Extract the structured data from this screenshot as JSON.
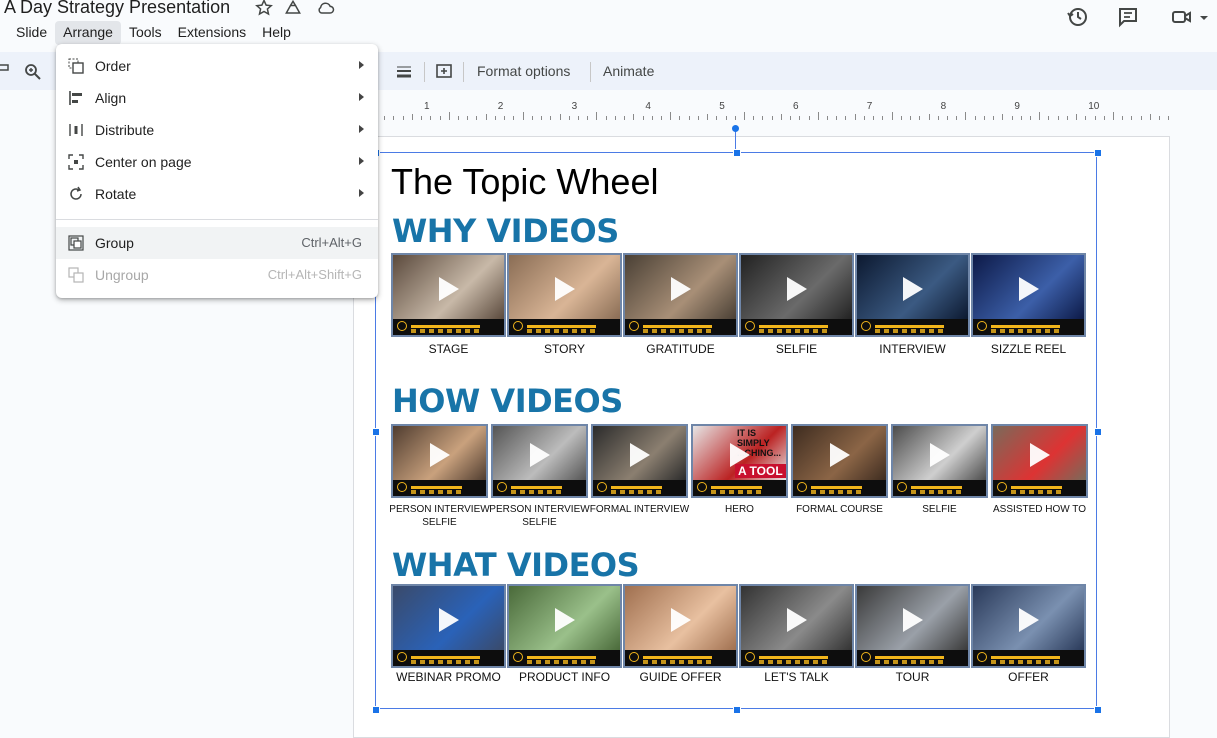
{
  "app": {
    "doc_title": "r A Day Strategy Presentation",
    "menus": [
      "Slide",
      "Arrange",
      "Tools",
      "Extensions",
      "Help"
    ],
    "active_menu": "Arrange"
  },
  "toolbar": {
    "format_options": "Format options",
    "animate": "Animate"
  },
  "ruler": {
    "numbers": [
      "1",
      "2",
      "3",
      "4",
      "5",
      "6",
      "7",
      "8",
      "9",
      "10"
    ]
  },
  "arrange_menu": {
    "items": [
      {
        "label": "Order",
        "icon": "order-icon",
        "submenu": true
      },
      {
        "label": "Align",
        "icon": "align-icon",
        "submenu": true
      },
      {
        "label": "Distribute",
        "icon": "distribute-icon",
        "submenu": true
      },
      {
        "label": "Center on page",
        "icon": "center-icon",
        "submenu": true
      },
      {
        "label": "Rotate",
        "icon": "rotate-icon",
        "submenu": true
      },
      {
        "label": "Group",
        "icon": "group-icon",
        "shortcut": "Ctrl+Alt+G"
      },
      {
        "label": "Ungroup",
        "icon": "ungroup-icon",
        "shortcut": "Ctrl+Alt+Shift+G",
        "disabled": true
      }
    ]
  },
  "slide": {
    "title": "The Topic Wheel",
    "sections": [
      {
        "heading": "WHY VIDEOS",
        "videos": [
          "STAGE",
          "STORY",
          "GRATITUDE",
          "SELFIE",
          "INTERVIEW",
          "SIZZLE REEL"
        ]
      },
      {
        "heading": "HOW VIDEOS",
        "videos": [
          "PERSON INTERVIEW\nSELFIE",
          "PERSON INTERVIEW\nSELFIE",
          "FORMAL INTERVIEW",
          "HERO",
          "FORMAL COURSE",
          "SELFIE",
          "ASSISTED HOW TO"
        ]
      },
      {
        "heading": "WHAT VIDEOS",
        "videos": [
          "WEBINAR PROMO",
          "PRODUCT INFO",
          "GUIDE OFFER",
          "LET'S TALK",
          "TOUR",
          "OFFER"
        ]
      }
    ],
    "hero_overlay": {
      "line1": "IT IS",
      "line2": "SIMPLY",
      "line3": "...CHING...",
      "tag": "A TOOL"
    }
  },
  "colors": {
    "heading": "#1874a8",
    "selection": "#1a73e8",
    "player_accent": "#f1b51b"
  }
}
